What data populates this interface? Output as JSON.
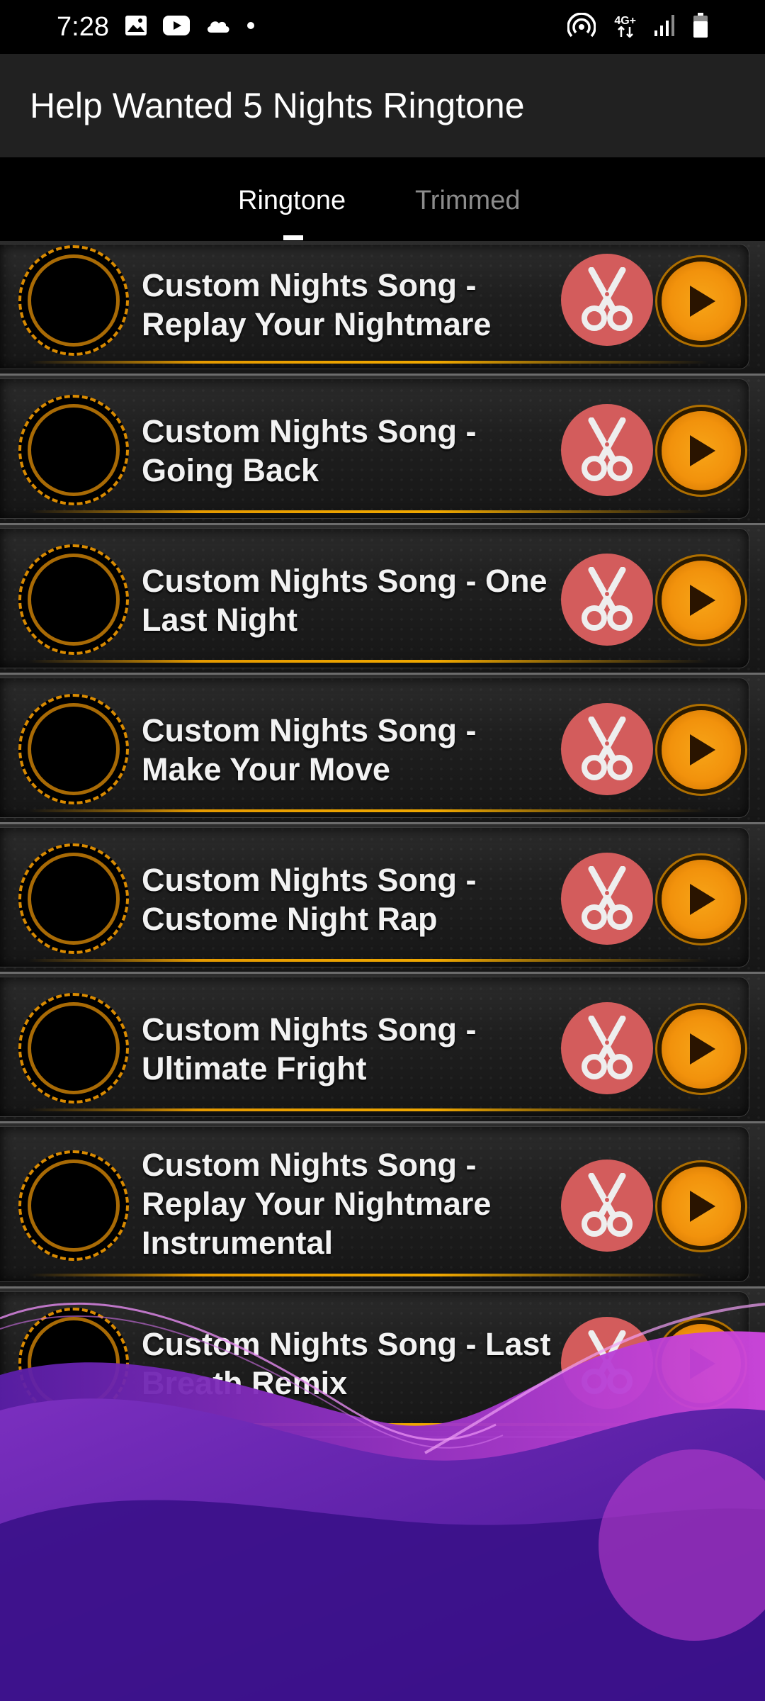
{
  "status_bar": {
    "time": "7:28",
    "network": "4G+",
    "icons_left": [
      "image-icon",
      "youtube-icon",
      "cloud-icon",
      "dot-icon"
    ],
    "icons_right": [
      "hotspot-icon",
      "network-arrows-icon",
      "signal-icon",
      "battery-icon"
    ]
  },
  "app_bar": {
    "title": "Help Wanted 5 Nights Ringtone"
  },
  "tabs": [
    {
      "label": "Ringtone",
      "selected": true
    },
    {
      "label": "Trimmed",
      "selected": false
    }
  ],
  "ringtones": [
    {
      "title": "Custom Nights Song - Replay Your Nightmare"
    },
    {
      "title": "Custom Nights Song - Going Back"
    },
    {
      "title": "Custom Nights Song - One Last Night"
    },
    {
      "title": "Custom Nights Song - Make Your Move"
    },
    {
      "title": "Custom Nights Song - Custome Night Rap"
    },
    {
      "title": "Custom Nights Song - Ultimate Fright"
    },
    {
      "title": "Custom Nights Song - Replay Your Nightmare Instrumental"
    },
    {
      "title": "Custom Nights Song - Last Breath Remix"
    }
  ],
  "colors": {
    "app_bar": "#212121",
    "cut_button": "#d35c5c",
    "play_button": "#f2920c",
    "disc_ring": "#d98a00",
    "overlay_purple": "#4a1a8c",
    "overlay_magenta": "#c03ad6"
  }
}
